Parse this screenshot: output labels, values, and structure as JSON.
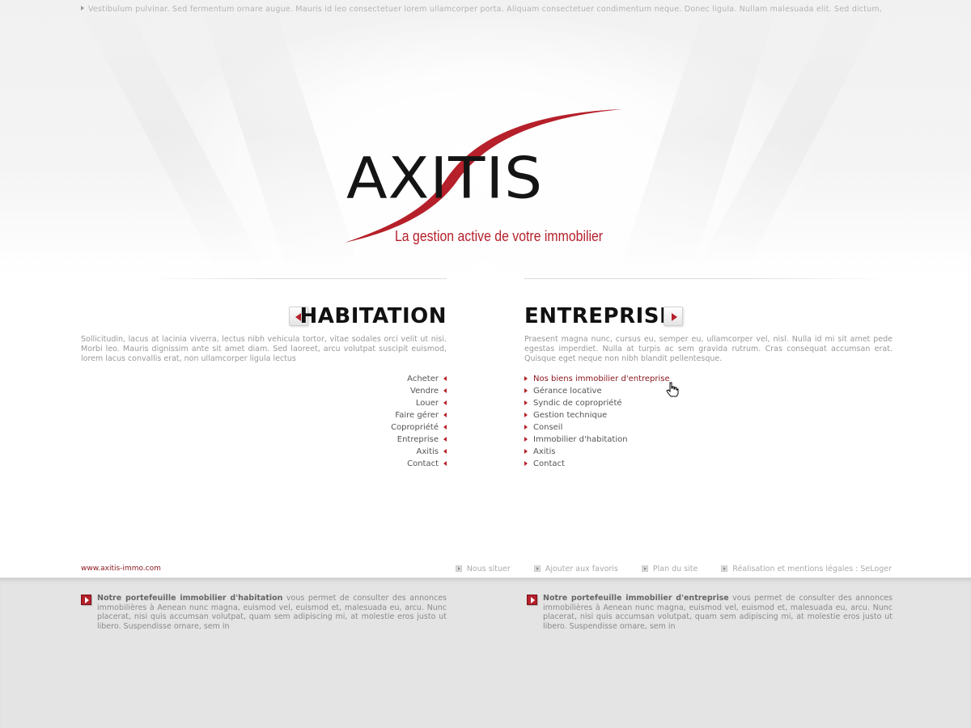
{
  "top_bar": {
    "text": "Vestibulum pulvinar. Sed fermentum ornare augue. Mauris id leo consectetuer lorem ullamcorper porta. Aliquam consectetuer condimentum neque. Donec ligula. Nullam malesuada elit. Sed dictum,"
  },
  "logo": {
    "name": "AXITIS",
    "tagline": "La gestion active de votre immobilier",
    "accent_color": "#b5202a"
  },
  "habitation": {
    "title": "HABITATION",
    "intro": "Sollicitudin, lacus at lacinia viverra, lectus nibh vehicula tortor, vitae sodales orci velit ut nisi. Morbi leo. Mauris dignissim ante sit amet diam. Sed laoreet, arcu volutpat suscipit euismod, lorem lacus convallis erat, non ullamcorper ligula lectus",
    "menu": [
      "Acheter",
      "Vendre",
      "Louer",
      "Faire gérer",
      "Copropriété",
      "Entreprise",
      "Axitis",
      "Contact"
    ]
  },
  "entreprise": {
    "title": "ENTREPRISE",
    "intro": "Praesent magna nunc, cursus eu, semper eu, ullamcorper vel, nisl. Nulla id mi sit amet pede egestas imperdiet. Nulla at turpis ac sem gravida rutrum. Cras consequat accumsan erat. Quisque eget neque non nibh blandit pellentesque.",
    "menu": [
      "Nos biens immobilier d'entreprise",
      "Gérance locative",
      "Syndic de copropriété",
      "Gestion technique",
      "Conseil",
      "Immobilier d'habitation",
      "Axitis",
      "Contact"
    ],
    "active_index": 0
  },
  "footer": {
    "url": "www.axitis-immo.com",
    "links": [
      "Nous situer",
      "Ajouter aux favoris",
      "Plan du site",
      "Réalisation et mentions légales : SeLoger"
    ]
  },
  "promos": {
    "habitation": {
      "bold": "Notre portefeuille immobilier d'habitation",
      "text": " vous permet de consulter des annonces immobilières à Aenean nunc magna, euismod vel, euismod et, malesuada eu, arcu. Nunc placerat, nisi quis accumsan volutpat, quam sem adipiscing mi, at molestie eros justo ut libero. Suspendisse ornare, sem in"
    },
    "entreprise": {
      "bold": "Notre portefeuille immobilier d'entreprise",
      "text": " vous permet de consulter des annonces immobilières à Aenean nunc magna, euismod vel, euismod et, malesuada eu, arcu. Nunc placerat, nisi quis accumsan volutpat, quam sem adipiscing mi, at molestie eros justo ut libero. Suspendisse ornare, sem in"
    }
  }
}
